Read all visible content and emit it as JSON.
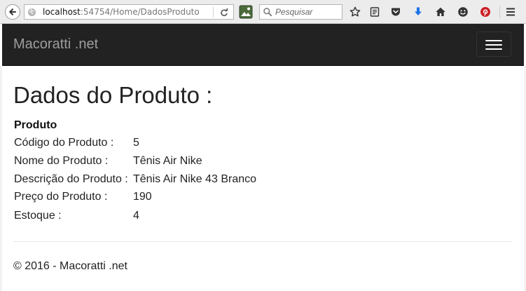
{
  "browser": {
    "url_host": "localhost",
    "url_path": ":54754/Home/DadosProduto",
    "search_placeholder": "Pesquisar"
  },
  "navbar": {
    "brand": "Macoratti .net"
  },
  "main": {
    "title": "Dados do Produto :",
    "section_label": "Produto",
    "fields": [
      {
        "label": "Código do Produto :",
        "value": "5"
      },
      {
        "label": "Nome do Produto :",
        "value": "Tênis Air Nike"
      },
      {
        "label": "Descrição do Produto :",
        "value": "Tênis Air Nike 43 Branco"
      },
      {
        "label": "Preço do Produto :",
        "value": "190"
      },
      {
        "label": "Estoque :",
        "value": "4"
      }
    ]
  },
  "footer": {
    "text": "© 2016 - Macoratti .net"
  },
  "icons": {
    "back": "back-arrow-icon",
    "site_info": "globe-icon",
    "reload": "reload-icon",
    "extension": "extension-icon",
    "search": "magnifier-icon",
    "toolbar": [
      "star-icon",
      "reading-list-icon",
      "pocket-icon",
      "download-icon",
      "home-icon",
      "emoji-icon",
      "pinterest-icon",
      "menu-icon"
    ]
  },
  "colors": {
    "navbar_bg": "#222222",
    "brand_text": "#9d9d9d",
    "download_icon": "#1a73e8",
    "pinterest_icon": "#cb2027"
  }
}
